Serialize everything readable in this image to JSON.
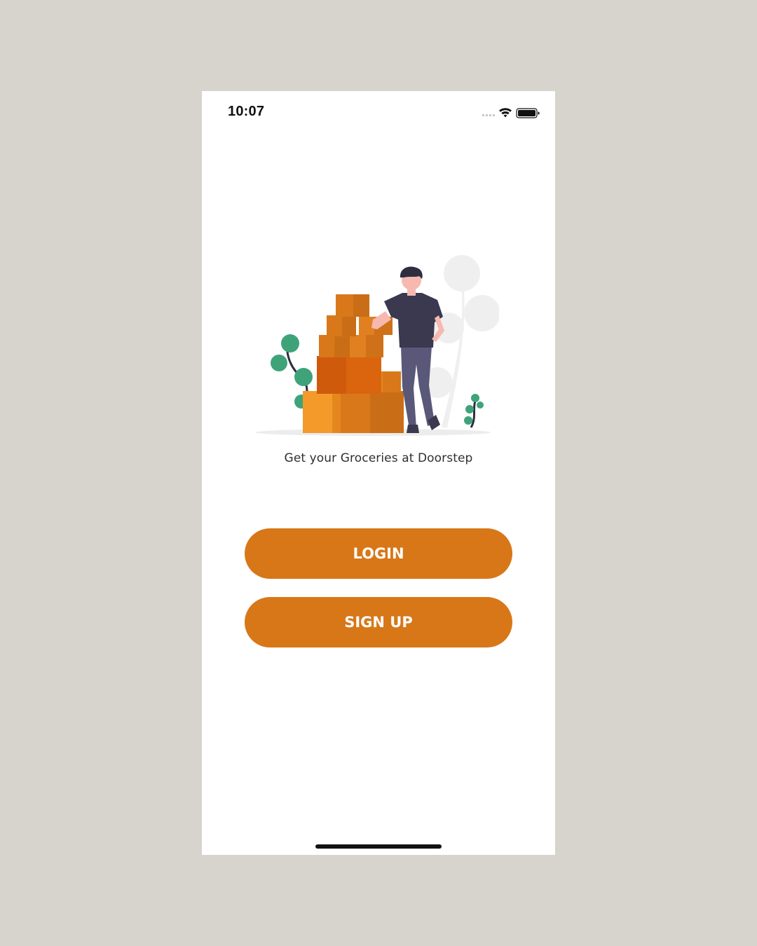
{
  "status_bar": {
    "time": "10:07",
    "icons": [
      "cellular-signal-icon",
      "wifi-icon",
      "battery-icon"
    ]
  },
  "hero": {
    "illustration": "delivery-man-with-boxes-illustration",
    "tagline": "Get your Groceries at Doorstep"
  },
  "actions": {
    "login_label": "LOGIN",
    "signup_label": "SIGN UP"
  },
  "colors": {
    "accent": "#d87718",
    "background": "#d7d3cd",
    "screen": "#ffffff"
  }
}
